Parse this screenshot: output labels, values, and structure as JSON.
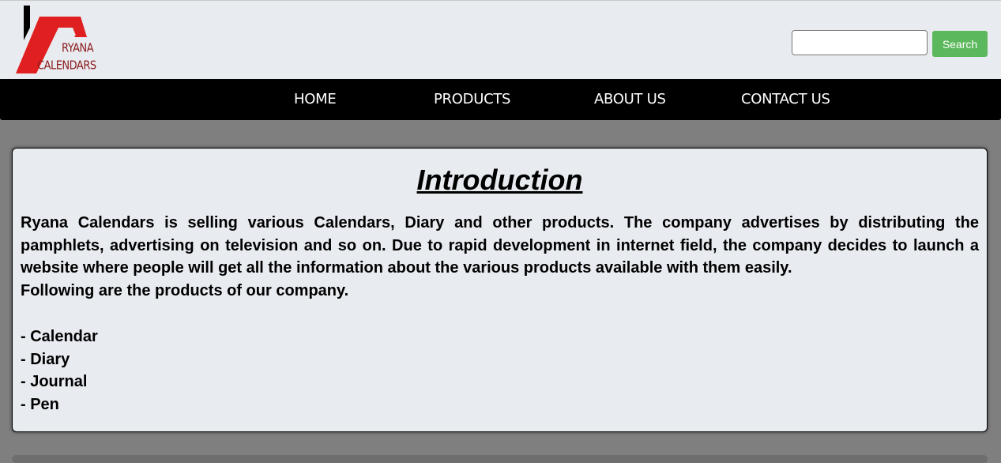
{
  "header": {
    "logo": {
      "brand_line1": "RYANA",
      "brand_line2": "CALENDARS",
      "colors": {
        "bar": "#000000",
        "roof": "#e02020",
        "text": "#8b1a1a"
      }
    },
    "search": {
      "placeholder": "",
      "value": "",
      "button_label": "Search",
      "button_color": "#5cb85c"
    }
  },
  "nav": {
    "items": [
      {
        "label": "HOME"
      },
      {
        "label": "PRODUCTS"
      },
      {
        "label": "ABOUT US"
      },
      {
        "label": "CONTACT US"
      }
    ]
  },
  "main": {
    "title": "Introduction",
    "paragraph": "Ryana Calendars is selling various Calendars, Diary and other products. The company advertises by distributing the pamphlets, advertising on television and so on. Due to rapid development in internet field, the company decides to launch a website where people will get all the information about the various products available with them easily.",
    "follow_text": "Following are the products of our company.",
    "products": [
      "- Calendar",
      "- Diary",
      "- Journal",
      "- Pen"
    ]
  }
}
